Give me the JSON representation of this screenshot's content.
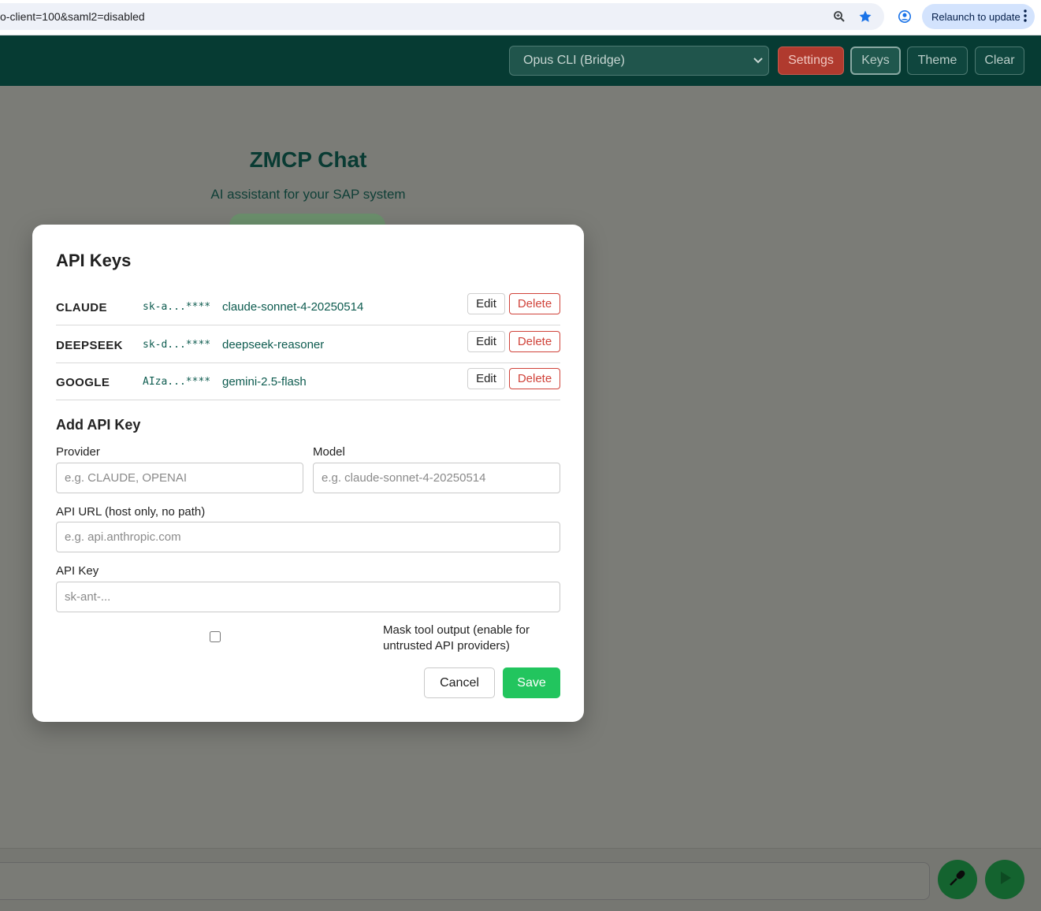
{
  "browser": {
    "url": "o-client=100&saml2=disabled",
    "relaunch_label": "Relaunch to update",
    "icons": [
      "zoom-icon",
      "bookmark-star-icon",
      "profile-icon",
      "more-vert-icon"
    ]
  },
  "header": {
    "model_selected": "Opus CLI (Bridge)",
    "buttons": {
      "settings": "Settings",
      "keys": "Keys",
      "theme": "Theme",
      "clear": "Clear"
    }
  },
  "page": {
    "title": "ZMCP Chat",
    "subtitle": "AI assistant for your SAP system"
  },
  "modal": {
    "title": "API Keys",
    "keys": [
      {
        "provider": "CLAUDE",
        "masked": "sk-a...****",
        "model": "claude-sonnet-4-20250514",
        "edit": "Edit",
        "delete": "Delete"
      },
      {
        "provider": "DEEPSEEK",
        "masked": "sk-d...****",
        "model": "deepseek-reasoner",
        "edit": "Edit",
        "delete": "Delete"
      },
      {
        "provider": "GOOGLE",
        "masked": "AIza...****",
        "model": "gemini-2.5-flash",
        "edit": "Edit",
        "delete": "Delete"
      }
    ],
    "add": {
      "title": "Add API Key",
      "provider_label": "Provider",
      "provider_placeholder": "e.g. CLAUDE, OPENAI",
      "model_label": "Model",
      "model_placeholder": "e.g. claude-sonnet-4-20250514",
      "url_label": "API URL (host only, no path)",
      "url_placeholder": "e.g. api.anthropic.com",
      "key_label": "API Key",
      "key_placeholder": "sk-ant-...",
      "mask_label": "Mask tool output (enable for untrusted API providers)",
      "mask_checked": false
    },
    "cancel": "Cancel",
    "save": "Save"
  },
  "colors": {
    "header_bg": "#063b33",
    "accent_green": "#22c55e",
    "danger": "#d0433a",
    "settings_bg": "#b03a2e",
    "link_teal": "#0d5b4f"
  }
}
